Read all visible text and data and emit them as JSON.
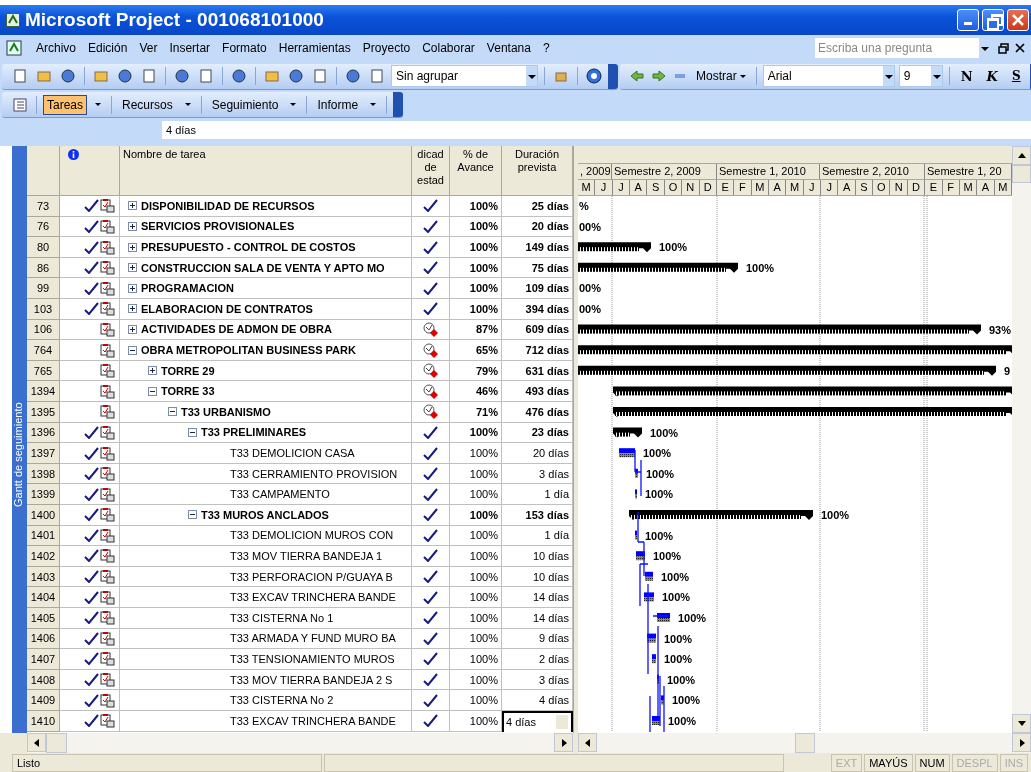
{
  "window": {
    "title": "Microsoft Project - 001068101000"
  },
  "menu": [
    "Archivo",
    "Edición",
    "Ver",
    "Insertar",
    "Formato",
    "Herramientas",
    "Proyecto",
    "Colaborar",
    "Ventana",
    "?"
  ],
  "help_box": {
    "placeholder": "Escriba una pregunta"
  },
  "toolbar": {
    "group_select": "Sin agrupar",
    "show_button": "Mostrar",
    "font": "Arial",
    "font_size": "9",
    "format_buttons": [
      "N",
      "K",
      "S"
    ]
  },
  "guide_tabs": [
    {
      "label": "Tareas",
      "selected": true
    },
    {
      "label": "Recursos",
      "selected": false
    },
    {
      "label": "Seguimiento",
      "selected": false
    },
    {
      "label": "Informe",
      "selected": false
    }
  ],
  "entry_bar": {
    "value": "4 días"
  },
  "view_bar": {
    "label": "Gantt de seguimiento"
  },
  "table": {
    "columns": [
      "Nombre de tarea",
      "dicad de estad",
      "% de Avance",
      "Duración prevista"
    ],
    "rows": [
      {
        "id": "73",
        "done": true,
        "name": "DISPONIBILIDAD DE RECURSOS",
        "summary": true,
        "expanded": false,
        "late": false,
        "percent": "100%",
        "duration": "25 días",
        "editing": false,
        "bar": {
          "kind": "none",
          "label": "%"
        }
      },
      {
        "id": "76",
        "done": true,
        "name": "SERVICIOS PROVISIONALES",
        "summary": true,
        "expanded": false,
        "late": false,
        "percent": "100%",
        "duration": "20 días",
        "editing": false,
        "bar": {
          "kind": "none",
          "label": "00%"
        }
      },
      {
        "id": "80",
        "done": true,
        "name": "PRESUPUESTO - CONTROL DE COSTOS",
        "summary": true,
        "expanded": false,
        "late": false,
        "percent": "100%",
        "duration": "149 días",
        "editing": false,
        "bar": {
          "kind": "summary",
          "label": "100%"
        }
      },
      {
        "id": "86",
        "done": true,
        "name": "CONSTRUCCION SALA DE VENTA Y APTO MO",
        "summary": true,
        "expanded": false,
        "late": false,
        "percent": "100%",
        "duration": "75 días",
        "editing": false,
        "bar": {
          "kind": "summary",
          "label": "100%"
        }
      },
      {
        "id": "99",
        "done": true,
        "name": "PROGRAMACION",
        "summary": true,
        "expanded": false,
        "late": false,
        "percent": "100%",
        "duration": "109 días",
        "editing": false,
        "bar": {
          "kind": "none",
          "label": "00%"
        }
      },
      {
        "id": "103",
        "done": true,
        "name": "ELABORACION DE CONTRATOS",
        "summary": true,
        "expanded": false,
        "late": false,
        "percent": "100%",
        "duration": "394 días",
        "editing": false,
        "bar": {
          "kind": "none",
          "label": "00%"
        }
      },
      {
        "id": "106",
        "done": false,
        "name": "ACTIVIDADES DE ADMON DE OBRA",
        "summary": true,
        "expanded": false,
        "late": true,
        "percent": "87%",
        "duration": "609 días",
        "editing": false,
        "bar": {
          "kind": "summary",
          "label": "93%"
        }
      },
      {
        "id": "764",
        "done": false,
        "name": "OBRA METROPOLITAN BUSINESS PARK",
        "summary": true,
        "expanded": true,
        "late": true,
        "percent": "65%",
        "duration": "712 días",
        "editing": false,
        "bar": {
          "kind": "summary"
        },
        "children": [
          {
            "id": "765",
            "done": false,
            "name": "TORRE 29",
            "summary": true,
            "expanded": false,
            "late": true,
            "percent": "79%",
            "duration": "631 días",
            "editing": false,
            "bar": {
              "kind": "summary",
              "label": "9"
            }
          },
          {
            "id": "1394",
            "done": false,
            "name": "TORRE 33",
            "summary": true,
            "expanded": true,
            "late": true,
            "percent": "46%",
            "duration": "493 días",
            "editing": false,
            "bar": {
              "kind": "summary"
            },
            "children": [
              {
                "id": "1395",
                "done": false,
                "name": "T33 URBANISMO",
                "summary": true,
                "expanded": true,
                "late": true,
                "percent": "71%",
                "duration": "476 días",
                "editing": false,
                "bar": {
                  "kind": "summary"
                },
                "children": [
                  {
                    "id": "1396",
                    "done": true,
                    "name": "T33 PRELIMINARES",
                    "summary": true,
                    "expanded": true,
                    "late": false,
                    "percent": "100%",
                    "duration": "23 días",
                    "editing": false,
                    "bar": {
                      "kind": "summary",
                      "label": "100%"
                    },
                    "children": [
                      {
                        "id": "1397",
                        "done": true,
                        "name": "T33 DEMOLICION CASA",
                        "summary": false,
                        "late": false,
                        "percent": "100%",
                        "duration": "20 días",
                        "editing": false,
                        "bar": {
                          "kind": "task",
                          "label": "100%"
                        }
                      },
                      {
                        "id": "1398",
                        "done": true,
                        "name": "T33 CERRAMIENTO PROVISION",
                        "summary": false,
                        "late": false,
                        "percent": "100%",
                        "duration": "3 días",
                        "editing": false,
                        "bar": {
                          "kind": "task",
                          "label": "100%"
                        }
                      },
                      {
                        "id": "1399",
                        "done": true,
                        "name": "T33 CAMPAMENTO",
                        "summary": false,
                        "late": false,
                        "percent": "100%",
                        "duration": "1 día",
                        "editing": false,
                        "bar": {
                          "kind": "task",
                          "label": "100%"
                        }
                      }
                    ]
                  },
                  {
                    "id": "1400",
                    "done": true,
                    "name": "T33 MUROS ANCLADOS",
                    "summary": true,
                    "expanded": true,
                    "late": false,
                    "percent": "100%",
                    "duration": "153 días",
                    "editing": false,
                    "bar": {
                      "kind": "summary",
                      "label": "100%"
                    },
                    "children": [
                      {
                        "id": "1401",
                        "done": true,
                        "name": "T33 DEMOLICION MUROS CON",
                        "summary": false,
                        "late": false,
                        "percent": "100%",
                        "duration": "1 día",
                        "editing": false,
                        "bar": {
                          "kind": "task",
                          "label": "100%"
                        }
                      },
                      {
                        "id": "1402",
                        "done": true,
                        "name": "T33 MOV TIERRA BANDEJA 1",
                        "summary": false,
                        "late": false,
                        "percent": "100%",
                        "duration": "10 días",
                        "editing": false,
                        "bar": {
                          "kind": "task",
                          "label": "100%"
                        }
                      },
                      {
                        "id": "1403",
                        "done": true,
                        "name": "T33 PERFORACION P/GUAYA B",
                        "summary": false,
                        "late": false,
                        "percent": "100%",
                        "duration": "10 días",
                        "editing": false,
                        "bar": {
                          "kind": "task",
                          "label": "100%"
                        }
                      },
                      {
                        "id": "1404",
                        "done": true,
                        "name": "T33 EXCAV TRINCHERA BANDE",
                        "summary": false,
                        "late": false,
                        "percent": "100%",
                        "duration": "14 días",
                        "editing": false,
                        "bar": {
                          "kind": "task",
                          "label": "100%"
                        }
                      },
                      {
                        "id": "1405",
                        "done": true,
                        "name": "T33 CISTERNA No 1",
                        "summary": false,
                        "late": false,
                        "percent": "100%",
                        "duration": "14 días",
                        "editing": false,
                        "bar": {
                          "kind": "task",
                          "label": "100%"
                        }
                      },
                      {
                        "id": "1406",
                        "done": true,
                        "name": "T33 ARMADA Y FUND MURO BA",
                        "summary": false,
                        "late": false,
                        "percent": "100%",
                        "duration": "9 días",
                        "editing": false,
                        "bar": {
                          "kind": "task",
                          "label": "100%"
                        }
                      },
                      {
                        "id": "1407",
                        "done": true,
                        "name": "T33 TENSIONAMIENTO MUROS",
                        "summary": false,
                        "late": false,
                        "percent": "100%",
                        "duration": "2 días",
                        "editing": false,
                        "bar": {
                          "kind": "task",
                          "label": "100%"
                        }
                      },
                      {
                        "id": "1408",
                        "done": true,
                        "name": "T33 MOV TIERRA BANDEJA 2 S",
                        "summary": false,
                        "late": false,
                        "percent": "100%",
                        "duration": "3 días",
                        "editing": false,
                        "bar": {
                          "kind": "task",
                          "label": "100%"
                        }
                      },
                      {
                        "id": "1409",
                        "done": true,
                        "name": "T33 CISTERNA No 2",
                        "summary": false,
                        "late": false,
                        "percent": "100%",
                        "duration": "4 días",
                        "editing": false,
                        "bar": {
                          "kind": "task",
                          "label": "100%"
                        }
                      },
                      {
                        "id": "1410",
                        "done": true,
                        "name": "T33 EXCAV TRINCHERA BANDE",
                        "summary": false,
                        "late": false,
                        "percent": "100%",
                        "duration": "4 días",
                        "editing": true,
                        "bar": {
                          "kind": "task",
                          "label": "100%"
                        }
                      }
                    ]
                  }
                ]
              }
            ]
          }
        ]
      }
    ]
  },
  "timescale": {
    "periods": [
      ", 2009",
      "Semestre 2, 2009",
      "Semestre 1, 2010",
      "Semestre 2, 2010",
      "Semestre 1, 20"
    ],
    "months": [
      "M",
      "J",
      "J",
      "A",
      "S",
      "O",
      "N",
      "D",
      "E",
      "F",
      "M",
      "A",
      "M",
      "J",
      "J",
      "A",
      "S",
      "O",
      "N",
      "D",
      "E",
      "F",
      "M",
      "A",
      "M"
    ]
  },
  "status_bar": {
    "message": "Listo",
    "indicators": [
      {
        "label": "EXT",
        "on": false
      },
      {
        "label": "MAYÚS",
        "on": true
      },
      {
        "label": "NUM",
        "on": true
      },
      {
        "label": "DESPL",
        "on": false
      },
      {
        "label": "INS",
        "on": false
      }
    ]
  }
}
